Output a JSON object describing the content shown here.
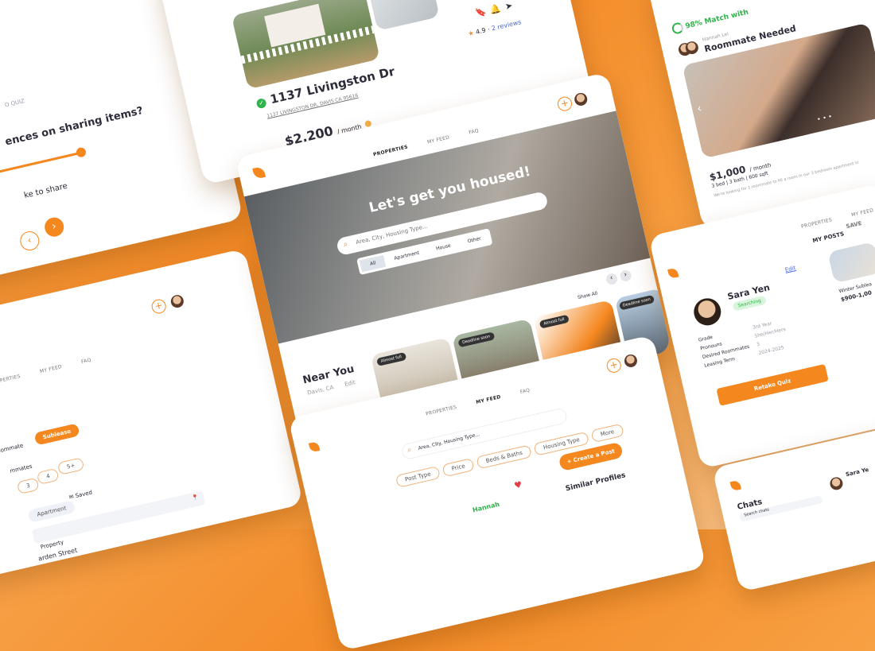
{
  "colors": {
    "accent": "#f5871f",
    "background": "#f38a26",
    "success": "#2fb34a",
    "link": "#4d6bd6"
  },
  "quiz_card": {
    "label": "O QUIZ",
    "question": "ences on sharing items?",
    "slider_value": 0.62,
    "answer_hint": "ke to share"
  },
  "listing_card": {
    "title": "1137 Livingston Dr",
    "address": "1137 LIVINGSTON DR, DAVIS CA 95616",
    "price": "$2,200",
    "price_unit": "/ month",
    "rating": "4.9",
    "reviews": "2 reviews"
  },
  "match_card": {
    "match": "98% Match with",
    "poster": "Hannah Lei",
    "title": "Roommate Needed",
    "price": "$1,000",
    "price_unit": "/ month",
    "stats": "3 bed | 3 bath | 600 sqft",
    "description": "We're looking for 1 roommate to fill a room in our 3 bedroom apartment in"
  },
  "home_card": {
    "nav": [
      "PROPERTIES",
      "MY FEED",
      "FAQ"
    ],
    "hero_title": "Let's get you housed!",
    "search_placeholder": "Area, City, Housing Type...",
    "filters": [
      "All",
      "Apartment",
      "House",
      "Other"
    ],
    "section_title": "Near You",
    "location": "Davis, CA",
    "edit": "Edit",
    "show_all": "Show All",
    "tags": [
      "Almost full",
      "Deadline soon",
      "Almost full",
      "Deadline soon"
    ]
  },
  "post_filter_card": {
    "nav": [
      "PROPERTIES",
      "MY FEED",
      "FAQ"
    ],
    "roommate_label": "oommate",
    "sublease": "Sublease",
    "roommates_label": "mmates",
    "counts": [
      "3",
      "4",
      "5+"
    ],
    "apartment": "Apartment",
    "saved": "Saved",
    "property_label": "Property",
    "street": "arden Street"
  },
  "profile_card": {
    "nav": [
      "PROPERTIES",
      "MY FEED"
    ],
    "name": "Sara Yen",
    "status": "Searching",
    "edit": "Edit",
    "fields": [
      {
        "label": "Grade",
        "value": "3rd Year"
      },
      {
        "label": "Pronouns",
        "value": "She/Her/Hers"
      },
      {
        "label": "Desired Roommates",
        "value": "3"
      },
      {
        "label": "Leasing Term",
        "value": "2024-2025"
      }
    ],
    "retake": "Retake Quiz",
    "my_posts": "MY POSTS",
    "saved": "SAVE",
    "post_title": "Winter Sublea",
    "post_price": "$900-1,00"
  },
  "feed_card": {
    "nav": [
      "PROPERTIES",
      "MY FEED",
      "FAQ"
    ],
    "search_placeholder": "Area, City, Housing Type...",
    "filters": [
      "Post Type",
      "Price",
      "Beds & Baths",
      "Housing Type",
      "More"
    ],
    "create_post": "+ Create a Post",
    "similar": "Similar Profiles",
    "name_snippet": "Hannah"
  },
  "chat_card": {
    "title": "Chats",
    "search": "Search chats",
    "name": "Sara Ye"
  }
}
